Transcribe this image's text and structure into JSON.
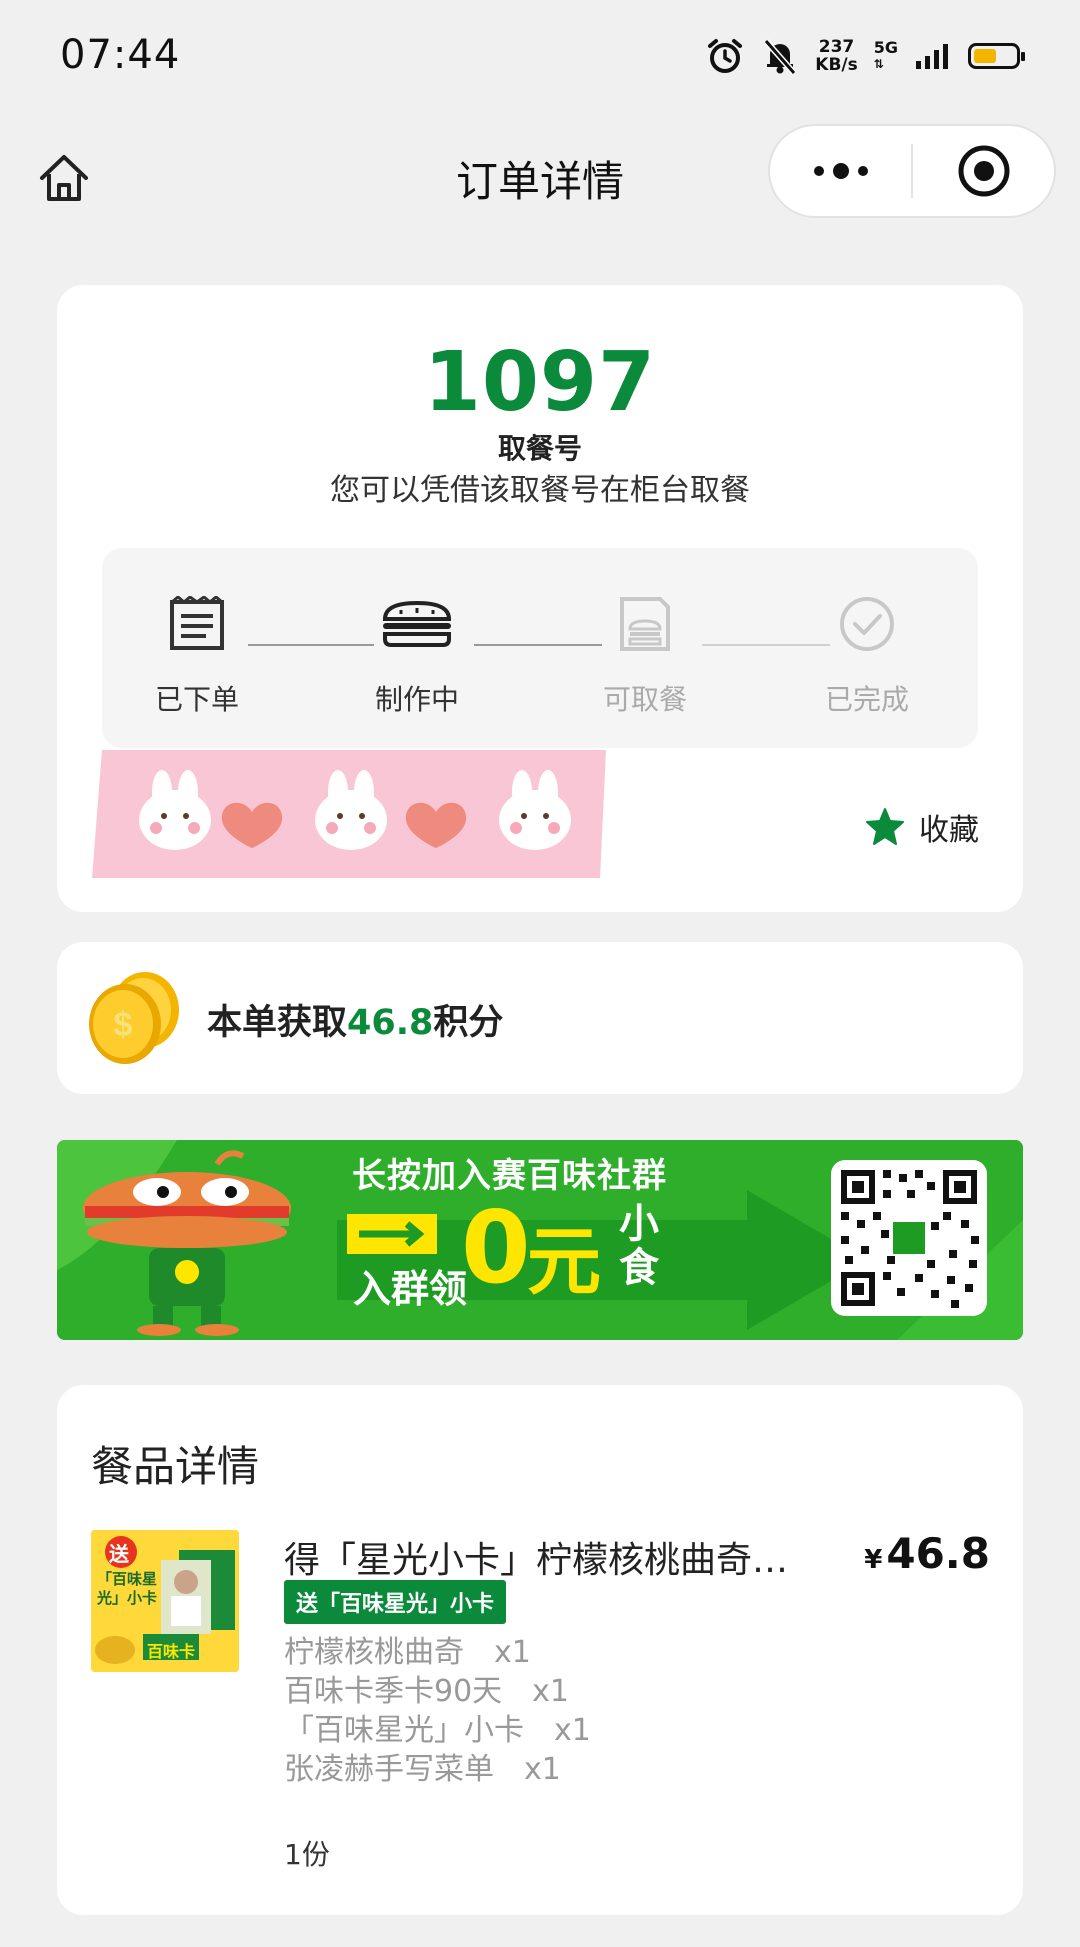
{
  "status_bar": {
    "time": "07:44",
    "net_speed_value": "237",
    "net_speed_unit": "KB/s",
    "network": "5G",
    "battery_level": 0.55,
    "battery_color": "#f2b600"
  },
  "nav": {
    "title": "订单详情",
    "home_icon": "home-icon",
    "more_icon": "more-dots-icon",
    "close_icon": "target-circle-icon"
  },
  "pickup": {
    "number": "1097",
    "label": "取餐号",
    "description": "您可以凭借该取餐号在柜台取餐",
    "steps": [
      {
        "label": "已下单",
        "icon": "receipt-icon",
        "state": "done"
      },
      {
        "label": "制作中",
        "icon": "burger-icon",
        "state": "active"
      },
      {
        "label": "可取餐",
        "icon": "bag-icon",
        "state": "pending"
      },
      {
        "label": "已完成",
        "icon": "check-circle-icon",
        "state": "pending"
      }
    ],
    "favorite_label": "收藏"
  },
  "points": {
    "prefix": "本单获取",
    "value": "46.8",
    "suffix": "积分"
  },
  "banner": {
    "title": "长按加入赛百味社群",
    "line_left": "入群领",
    "zero": "0",
    "yuan": "元",
    "small": "小食"
  },
  "items": {
    "title": "餐品详情",
    "product": {
      "name": "得「星光小卡」柠檬核桃曲奇…",
      "price_symbol": "¥",
      "price": "46.8",
      "tag": "送「百味星光」小卡",
      "image_text_gift": "送",
      "image_text_card": "「百味星光」小卡",
      "image_text_badge": "百味卡",
      "sub_items": [
        "柠檬核桃曲奇　x1",
        "百味卡季卡90天　x1",
        "「百味星光」小卡　x1",
        "张凌赫手写菜单　x1"
      ],
      "quantity": "1份"
    }
  },
  "colors": {
    "brand_green": "#0b8a3c",
    "banner_green": "#2eae2a",
    "banner_yellow": "#ffe600"
  }
}
